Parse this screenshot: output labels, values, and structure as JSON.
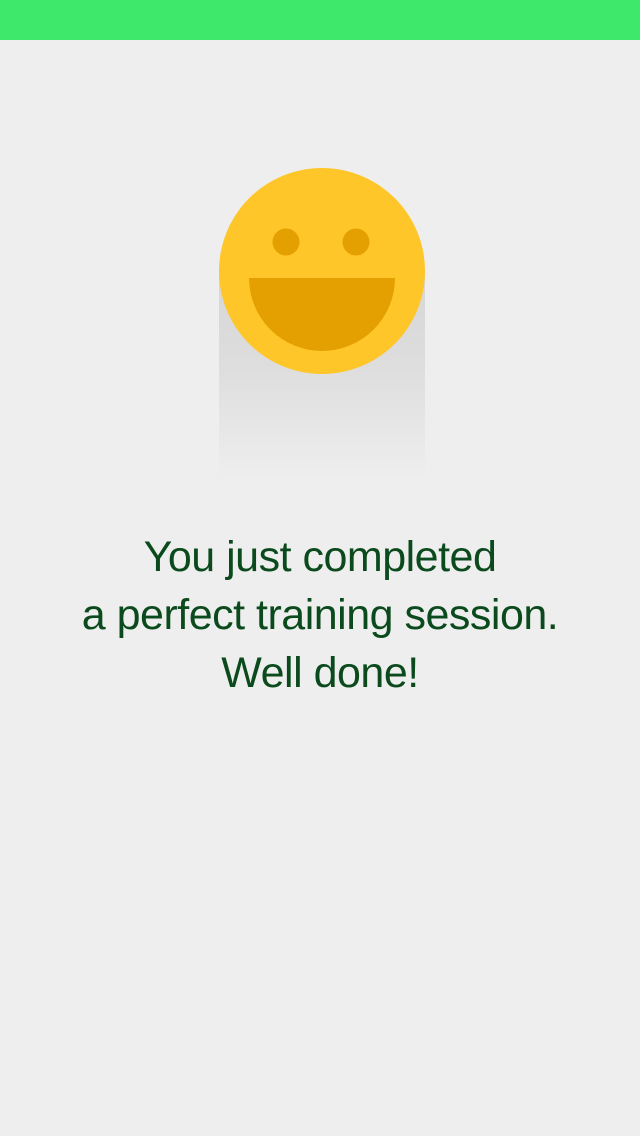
{
  "theme": {
    "status_bar_color": "#3de86b",
    "background_color": "#eeeeee",
    "text_color": "#0b4a1c",
    "smiley_face_color": "#ffc62a",
    "smiley_feature_color": "#e3a000"
  },
  "illustration": {
    "icon": "smiley-face-icon"
  },
  "message": {
    "line1": "You just completed",
    "line2": "a perfect training session.",
    "line3": "Well done!"
  }
}
